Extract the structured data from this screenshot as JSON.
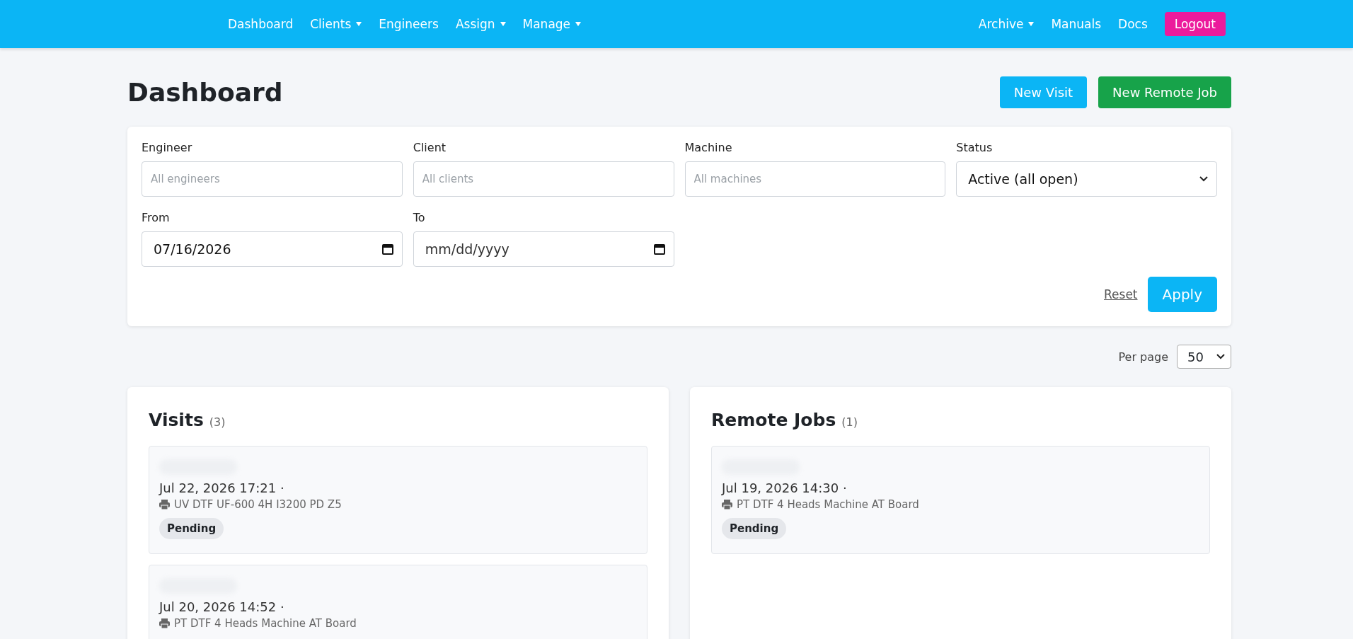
{
  "nav": {
    "left": [
      {
        "label": "Dashboard",
        "has_menu": false
      },
      {
        "label": "Clients",
        "has_menu": true
      },
      {
        "label": "Engineers",
        "has_menu": false
      },
      {
        "label": "Assign",
        "has_menu": true
      },
      {
        "label": "Manage",
        "has_menu": true
      }
    ],
    "right": [
      {
        "label": "Archive",
        "has_menu": true
      },
      {
        "label": "Manuals",
        "has_menu": false
      },
      {
        "label": "Docs",
        "has_menu": false
      }
    ],
    "logout": "Logout"
  },
  "title": "Dashboard",
  "actions": [
    {
      "label": "New Visit",
      "kind": "primary"
    },
    {
      "label": "New Remote Job",
      "kind": "success"
    }
  ],
  "filters": {
    "fields": [
      {
        "label": "Engineer",
        "kind": "text",
        "placeholder": "All engineers"
      },
      {
        "label": "Client",
        "kind": "text",
        "placeholder": "All clients"
      },
      {
        "label": "Machine",
        "kind": "text",
        "placeholder": "All machines"
      },
      {
        "label": "Status",
        "kind": "select",
        "value": "Active (all open)"
      },
      {
        "label": "From",
        "kind": "date",
        "value": "07/16/2026"
      },
      {
        "label": "To",
        "kind": "date",
        "placeholder": "mm/dd/yyyy"
      }
    ],
    "reset": "Reset",
    "apply": "Apply"
  },
  "per_page": {
    "label": "Per page",
    "value": "50"
  },
  "panels": [
    {
      "title": "Visits",
      "count": "(3)",
      "items": [
        {
          "date": "Jul 22, 2026 17:21 ·",
          "machine": "UV DTF UF-600 4H I3200 PD Z5",
          "status": "Pending"
        },
        {
          "date": "Jul 20, 2026 14:52 ·",
          "machine": "PT DTF 4 Heads Machine AT Board"
        }
      ]
    },
    {
      "title": "Remote Jobs",
      "count": "(1)",
      "items": [
        {
          "date": "Jul 19, 2026 14:30 ·",
          "machine": "PT DTF 4 Heads Machine AT Board",
          "status": "Pending"
        }
      ]
    }
  ]
}
